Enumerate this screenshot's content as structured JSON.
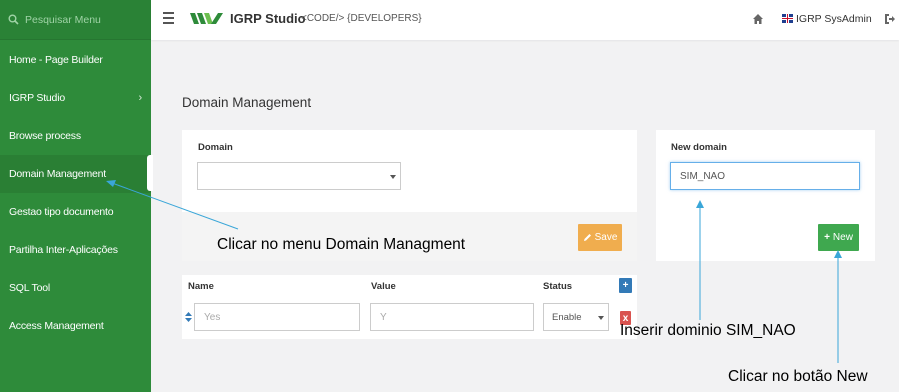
{
  "sidebar": {
    "search_placeholder": "Pesquisar Menu",
    "items": [
      {
        "label": "Home - Page Builder"
      },
      {
        "label": "IGRP Studio",
        "chevron": "›"
      },
      {
        "label": "Browse process"
      },
      {
        "label": "Domain Management",
        "active": true
      },
      {
        "label": "Gestao tipo documento"
      },
      {
        "label": "Partilha Inter-Aplicações"
      },
      {
        "label": "SQL Tool"
      },
      {
        "label": "Access Management"
      }
    ]
  },
  "topbar": {
    "brand": "IGRP Studio",
    "subtitle": "<CODE/> {DEVELOPERS}",
    "user": "IGRP SysAdmin"
  },
  "page": {
    "title": "Domain Management",
    "domain_box": {
      "label": "Domain",
      "select_value": "",
      "save_label": "Save"
    },
    "new_domain_box": {
      "label": "New domain",
      "value": "SIM_NAO",
      "new_label": "New"
    },
    "table": {
      "headers": [
        "Name",
        "Value",
        "Status"
      ],
      "add_label": "+",
      "row": {
        "name_placeholder": "Yes",
        "value_placeholder": "Y",
        "status_value": "Enable",
        "delete_label": "x"
      }
    }
  },
  "annotations": {
    "menu_note": "Clicar no menu Domain Managment",
    "insert_note": "Inserir dominio SIM_NAO",
    "new_note": "Clicar no botão New"
  },
  "colors": {
    "sidebar_bg": "#2e8b3a",
    "save_button": "#f0ad4e",
    "new_button": "#3fa84f",
    "add_button": "#337ab7",
    "delete_button": "#d9534f",
    "annotation_arrow": "#3aa6d8"
  }
}
